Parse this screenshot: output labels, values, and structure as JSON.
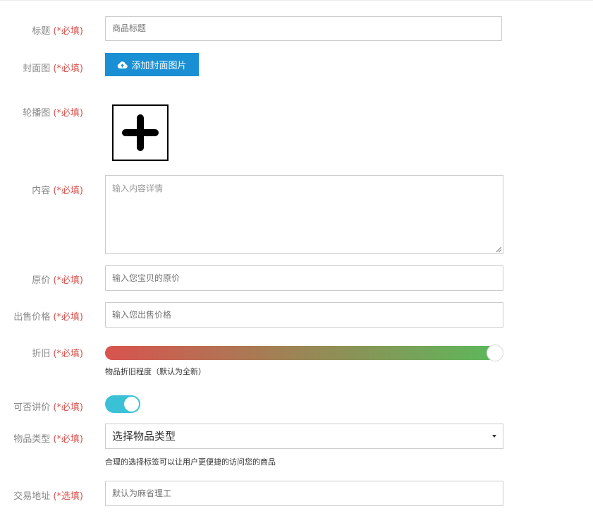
{
  "form": {
    "required_mark": "(*必填)",
    "optional_mark": "(*选填)",
    "title": {
      "label": "标题",
      "placeholder": "商品标题"
    },
    "cover": {
      "label": "封面图",
      "button_label": "添加封面图片"
    },
    "carousel": {
      "label": "轮播图"
    },
    "content": {
      "label": "内容",
      "placeholder": "输入内容详情"
    },
    "original_price": {
      "label": "原价",
      "placeholder": "输入您宝贝的原价"
    },
    "sale_price": {
      "label": "出售价格",
      "placeholder": "输入您出售价格"
    },
    "condition": {
      "label": "折旧",
      "hint": "物品折旧程度（默认为全新）",
      "value_fraction": 1.0
    },
    "negotiable": {
      "label": "可否讲价",
      "on": true
    },
    "category": {
      "label": "物品类型",
      "selected": "选择物品类型",
      "hint": "合理的选择标签可以让用户更便捷的访问您的商品"
    },
    "address": {
      "label": "交易地址",
      "placeholder": "默认为麻省理工"
    }
  },
  "colors": {
    "required": "#d9534f",
    "upload_button": "#1a8fd3",
    "toggle_on": "#3ac1d6",
    "slider_start": "#d9534f",
    "slider_end": "#5cb85c"
  },
  "icons": {
    "upload": "cloud-upload-icon",
    "add": "plus-icon",
    "select_caret": "caret-down-icon",
    "resize": "resize-handle-icon"
  }
}
